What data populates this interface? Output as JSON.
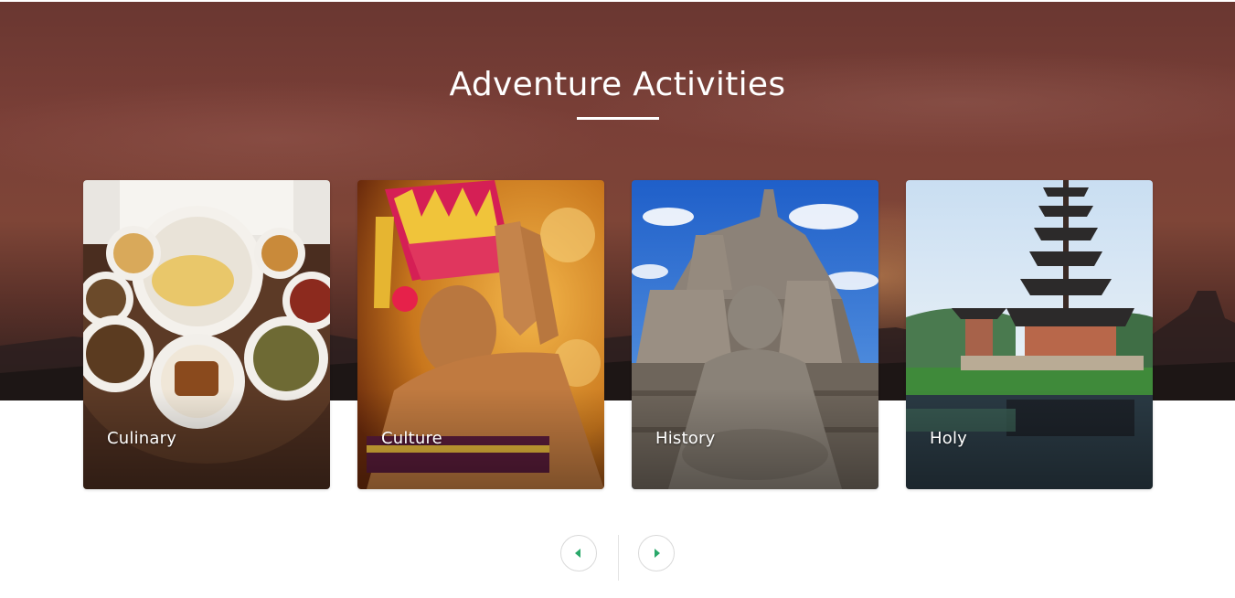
{
  "section": {
    "title": "Adventure Activities"
  },
  "cards": [
    {
      "label": "Culinary"
    },
    {
      "label": "Culture"
    },
    {
      "label": "History"
    },
    {
      "label": "Holy"
    }
  ],
  "navigation": {
    "prev_icon": "caret-left-icon",
    "next_icon": "caret-right-icon"
  },
  "colors": {
    "accent": "#2aa86a",
    "hero_sky": "#7a3f37",
    "text_on_image": "#ffffff"
  }
}
